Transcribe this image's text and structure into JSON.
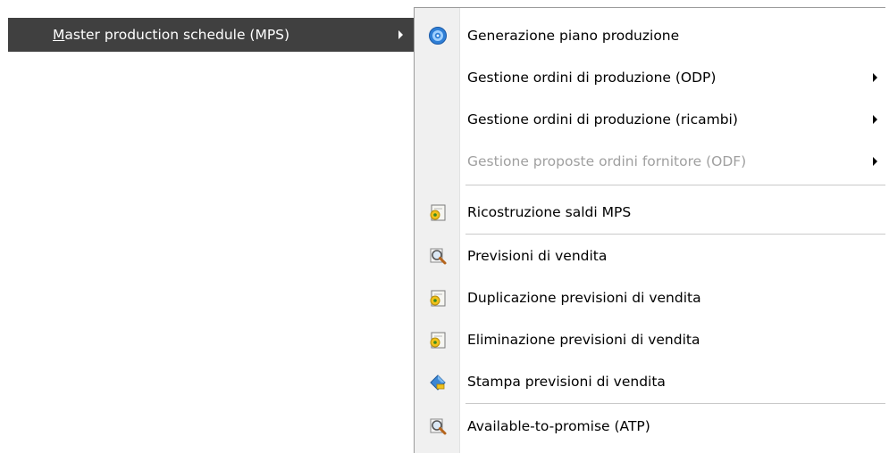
{
  "parent_menu": {
    "label": "Master production schedule (MPS)"
  },
  "submenu": {
    "items": [
      {
        "label": "Generazione piano produzione",
        "icon": "gear-globe-icon",
        "has_submenu": false,
        "enabled": true
      },
      {
        "label": "Gestione ordini di produzione (ODP)",
        "icon": null,
        "has_submenu": true,
        "enabled": true
      },
      {
        "label": "Gestione ordini di produzione (ricambi)",
        "icon": null,
        "has_submenu": true,
        "enabled": true
      },
      {
        "label": "Gestione proposte ordini fornitore (ODF)",
        "icon": null,
        "has_submenu": true,
        "enabled": false
      },
      {
        "label": "Ricostruzione saldi MPS",
        "icon": "procedure-gear-icon",
        "has_submenu": false,
        "enabled": true
      },
      {
        "label": "Previsioni di vendita",
        "icon": "magnifier-icon",
        "has_submenu": false,
        "enabled": true
      },
      {
        "label": "Duplicazione previsioni di vendita",
        "icon": "procedure-gear-icon",
        "has_submenu": false,
        "enabled": true
      },
      {
        "label": "Eliminazione previsioni di vendita",
        "icon": "procedure-gear-icon",
        "has_submenu": false,
        "enabled": true
      },
      {
        "label": "Stampa previsioni di vendita",
        "icon": "print-report-icon",
        "has_submenu": false,
        "enabled": true
      },
      {
        "label": "Available-to-promise (ATP)",
        "icon": "magnifier-icon",
        "has_submenu": false,
        "enabled": true
      }
    ]
  },
  "colors": {
    "highlight_bg": "#404040",
    "gutter_bg": "#f0f0f0",
    "disabled_text": "#a0a0a0"
  }
}
